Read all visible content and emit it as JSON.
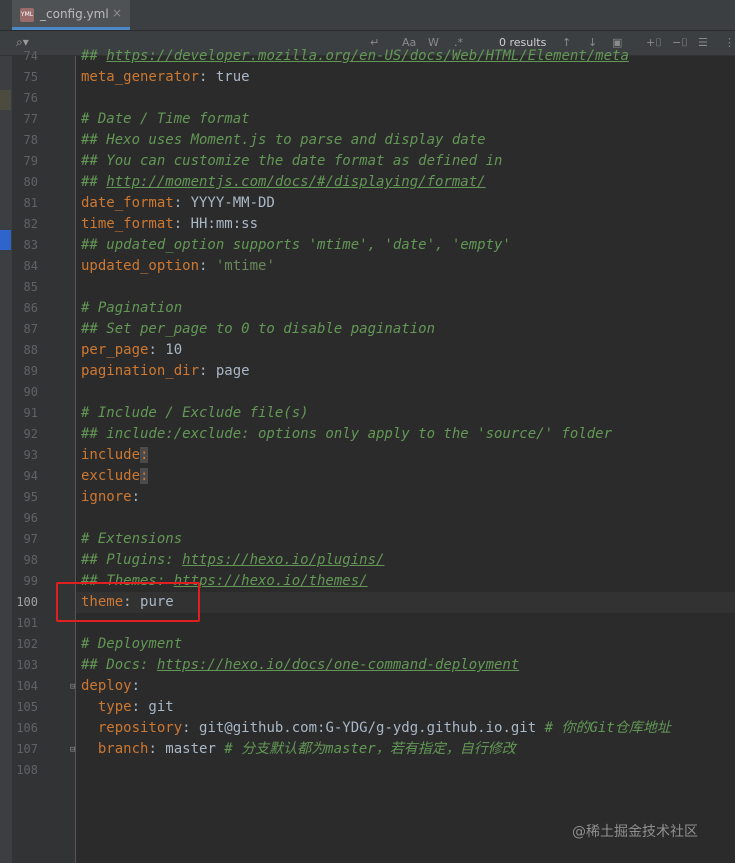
{
  "tab": {
    "icon": "yml-file-icon",
    "badge": "YML",
    "filename": "_config.yml",
    "close": "×"
  },
  "search": {
    "results": "0 results"
  },
  "lines": [
    {
      "n": "74",
      "parts": [
        [
          "c",
          "## "
        ],
        [
          "cu",
          "https://developer.mozilla.org/en-US/docs/Web/HTML/Element/meta"
        ]
      ]
    },
    {
      "n": "75",
      "parts": [
        [
          "k",
          "meta_generator"
        ],
        [
          "v",
          ": true"
        ]
      ]
    },
    {
      "n": "76",
      "parts": []
    },
    {
      "n": "77",
      "parts": [
        [
          "c",
          "# Date / Time format"
        ]
      ]
    },
    {
      "n": "78",
      "parts": [
        [
          "c",
          "## Hexo uses Moment.js to parse and display date"
        ]
      ]
    },
    {
      "n": "79",
      "parts": [
        [
          "c",
          "## You can customize the date format as defined in"
        ]
      ]
    },
    {
      "n": "80",
      "parts": [
        [
          "c",
          "## "
        ],
        [
          "cu",
          "http://momentjs.com/docs/#/displaying/format/"
        ]
      ]
    },
    {
      "n": "81",
      "parts": [
        [
          "k",
          "date_format"
        ],
        [
          "v",
          ": YYYY-MM-DD"
        ]
      ]
    },
    {
      "n": "82",
      "parts": [
        [
          "k",
          "time_format"
        ],
        [
          "v",
          ": HH:mm:ss"
        ]
      ]
    },
    {
      "n": "83",
      "parts": [
        [
          "c",
          "## updated_option supports 'mtime', 'date', 'empty'"
        ]
      ]
    },
    {
      "n": "84",
      "parts": [
        [
          "k",
          "updated_option"
        ],
        [
          "v",
          ": "
        ],
        [
          "s",
          "'mtime'"
        ]
      ]
    },
    {
      "n": "85",
      "parts": []
    },
    {
      "n": "86",
      "parts": [
        [
          "c",
          "# Pagination"
        ]
      ]
    },
    {
      "n": "87",
      "parts": [
        [
          "c",
          "## Set per_page to 0 to disable pagination"
        ]
      ]
    },
    {
      "n": "88",
      "parts": [
        [
          "k",
          "per_page"
        ],
        [
          "v",
          ": 10"
        ]
      ]
    },
    {
      "n": "89",
      "parts": [
        [
          "k",
          "pagination_dir"
        ],
        [
          "v",
          ": page"
        ]
      ]
    },
    {
      "n": "90",
      "parts": []
    },
    {
      "n": "91",
      "parts": [
        [
          "c",
          "# Include / Exclude file(s)"
        ]
      ]
    },
    {
      "n": "92",
      "parts": [
        [
          "c",
          "## include:/exclude: options only apply to the 'source/' folder"
        ]
      ]
    },
    {
      "n": "93",
      "parts": [
        [
          "k",
          "include"
        ],
        [
          "h",
          ":"
        ]
      ]
    },
    {
      "n": "94",
      "parts": [
        [
          "k",
          "exclude"
        ],
        [
          "h",
          ":"
        ]
      ]
    },
    {
      "n": "95",
      "parts": [
        [
          "k",
          "ignore"
        ],
        [
          "v",
          ":"
        ]
      ]
    },
    {
      "n": "96",
      "parts": []
    },
    {
      "n": "97",
      "parts": [
        [
          "c",
          "# Extensions"
        ]
      ]
    },
    {
      "n": "98",
      "parts": [
        [
          "c",
          "## Plugins: "
        ],
        [
          "cu",
          "https://hexo.io/plugins/"
        ]
      ]
    },
    {
      "n": "99",
      "parts": [
        [
          "c",
          "## Themes: "
        ],
        [
          "cu",
          "https://hexo.io/themes/"
        ]
      ]
    },
    {
      "n": "100",
      "parts": [
        [
          "k",
          "theme"
        ],
        [
          "v",
          ": pure"
        ]
      ]
    },
    {
      "n": "101",
      "parts": []
    },
    {
      "n": "102",
      "parts": [
        [
          "c",
          "# Deployment"
        ]
      ]
    },
    {
      "n": "103",
      "parts": [
        [
          "c",
          "## Docs: "
        ],
        [
          "cu",
          "https://hexo.io/docs/one-command-deployment"
        ]
      ]
    },
    {
      "n": "104",
      "parts": [
        [
          "k",
          "deploy"
        ],
        [
          "v",
          ":"
        ]
      ]
    },
    {
      "n": "105",
      "parts": [
        [
          "v",
          "  "
        ],
        [
          "k",
          "type"
        ],
        [
          "v",
          ": git"
        ]
      ]
    },
    {
      "n": "106",
      "parts": [
        [
          "v",
          "  "
        ],
        [
          "k",
          "repository"
        ],
        [
          "v",
          ": git@github.com:G-YDG/g-ydg.github.io.git "
        ],
        [
          "c",
          "# 你的Git仓库地址"
        ]
      ]
    },
    {
      "n": "107",
      "parts": [
        [
          "v",
          "  "
        ],
        [
          "k",
          "branch"
        ],
        [
          "v",
          ": master "
        ],
        [
          "c",
          "# 分支默认都为master，若有指定，自行修改"
        ]
      ]
    },
    {
      "n": "108",
      "parts": []
    }
  ],
  "watermark": "@稀土掘金技术社区"
}
